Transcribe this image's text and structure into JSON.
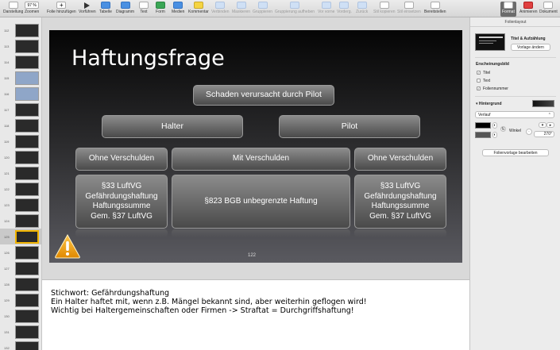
{
  "toolbar": {
    "items": [
      {
        "label": "Darstellung",
        "dim": false
      },
      {
        "label": "Zoomen",
        "dim": false
      },
      {
        "label": "Folie hinzufügen",
        "dim": false
      },
      {
        "label": "Vorführen",
        "dim": false
      },
      {
        "label": "Tabelle",
        "dim": false
      },
      {
        "label": "Diagramm",
        "dim": false
      },
      {
        "label": "Text",
        "dim": false
      },
      {
        "label": "Form",
        "dim": false
      },
      {
        "label": "Medien",
        "dim": false
      },
      {
        "label": "Kommentar",
        "dim": false
      },
      {
        "label": "Verbinden",
        "dim": true
      },
      {
        "label": "Maskieren",
        "dim": true
      },
      {
        "label": "Gruppieren",
        "dim": true
      },
      {
        "label": "Gruppierung aufheben",
        "dim": true
      },
      {
        "label": "Vor vorne",
        "dim": true
      },
      {
        "label": "Vorderg.",
        "dim": true
      },
      {
        "label": "Zurück",
        "dim": true
      },
      {
        "label": "Stil kopieren",
        "dim": true
      },
      {
        "label": "Stil einsetzen",
        "dim": true
      },
      {
        "label": "Bereitstellen",
        "dim": false
      },
      {
        "label": "Format",
        "dim": false
      },
      {
        "label": "Animieren",
        "dim": false
      },
      {
        "label": "Dokument",
        "dim": false
      }
    ],
    "zoom_value": "97 %"
  },
  "navigator": {
    "numbers": [
      "112",
      "113",
      "114",
      "115",
      "116",
      "117",
      "118",
      "119",
      "120",
      "121",
      "122",
      "123",
      "124",
      "125",
      "126",
      "127",
      "128",
      "129",
      "130",
      "131",
      "132"
    ]
  },
  "slide": {
    "title": "Haftungsfrage",
    "top_box": "Schaden verursacht durch Pilot",
    "halter": "Halter",
    "pilot": "Pilot",
    "ohne1": "Ohne Verschulden",
    "mit": "Mit Verschulden",
    "ohne2": "Ohne Verschulden",
    "left_detail": "§33 LuftVG\nGefährdungshaftung\nHaftungssumme\nGem. §37 LuftVG",
    "middle_detail": "§823 BGB unbegrenzte Haftung",
    "right_detail": "§33 LuftVG\nGefährdungshaftung\nHaftungssumme\nGem. §37 LuftVG",
    "number": "122"
  },
  "notes": {
    "line1": "Stichwort: Gefährdungshaftung",
    "line2": "Ein Halter haftet mit, wenn z.B. Mängel bekannt sind, aber weiterhin geflogen wird!",
    "line3": "Wichtig bei Haltergemeinschaften oder Firmen -> Straftat = Durchgriffshaftung!"
  },
  "inspector": {
    "header": "Folienlayout",
    "layout_name": "Titel & Aufzählung",
    "change_template": "Vorlage ändern",
    "appearance": "Erscheinungsbild",
    "chk_title": "Titel",
    "chk_text": "Text",
    "chk_slidenum": "Foliennummer",
    "background": "Hintergrund",
    "fill_type": "Verlauf",
    "angle_label": "Winkel",
    "angle_value": "270°",
    "edit_master": "Folienvorlage bearbeiten"
  },
  "colors": {
    "accent": "#2a6fdb",
    "warning": "#f0a000"
  }
}
